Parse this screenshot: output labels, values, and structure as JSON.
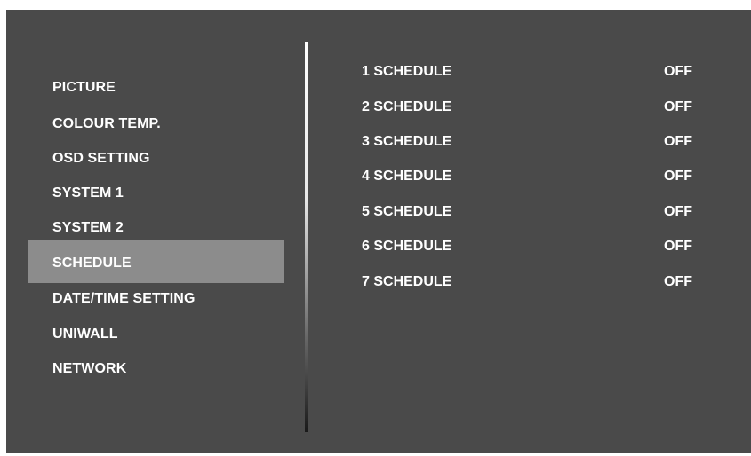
{
  "menu": {
    "items": [
      {
        "label": "PICTURE"
      },
      {
        "label": "COLOUR TEMP."
      },
      {
        "label": "OSD SETTING"
      },
      {
        "label": "SYSTEM 1"
      },
      {
        "label": "SYSTEM 2"
      },
      {
        "label": "SCHEDULE",
        "selected": true
      },
      {
        "label": "DATE/TIME SETTING"
      },
      {
        "label": "UNIWALL"
      },
      {
        "label": "NETWORK"
      }
    ]
  },
  "schedule": {
    "rows": [
      {
        "label": "1 SCHEDULE",
        "value": "OFF"
      },
      {
        "label": "2 SCHEDULE",
        "value": "OFF"
      },
      {
        "label": "3 SCHEDULE",
        "value": "OFF"
      },
      {
        "label": "4 SCHEDULE",
        "value": "OFF"
      },
      {
        "label": "5 SCHEDULE",
        "value": "OFF"
      },
      {
        "label": "6 SCHEDULE",
        "value": "OFF"
      },
      {
        "label": "7 SCHEDULE",
        "value": "OFF"
      }
    ]
  },
  "colors": {
    "background": "#4a4a4a",
    "selected_highlight": "#8c8c8c",
    "text": "#ffffff"
  }
}
